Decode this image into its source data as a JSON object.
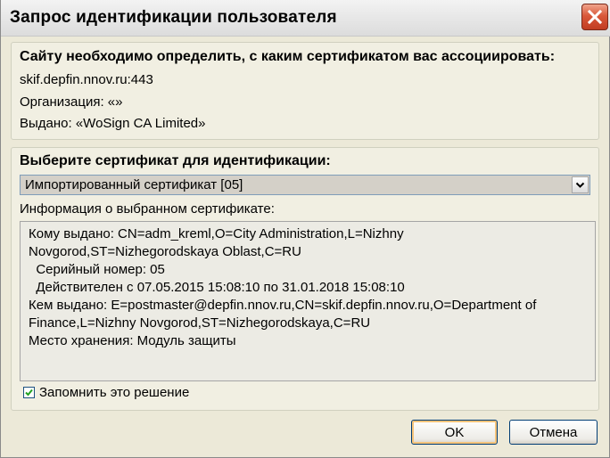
{
  "window": {
    "title": "Запрос идентификации пользователя",
    "close_icon": "close-icon"
  },
  "site_group": {
    "heading": "Сайту необходимо определить, с каким сертификатом вас ассоциировать:",
    "host": "skif.depfin.nnov.ru:443",
    "organization": "Организация: «»",
    "issued_by": "Выдано: «WoSign CA Limited»"
  },
  "cert_group": {
    "heading": "Выберите сертификат для идентификации:",
    "selected_certificate": "Импортированный сертификат [05]",
    "info_label": "Информация о выбранном сертификате:",
    "info_lines": [
      "Кому выдано: CN=adm_kreml,O=City Administration,L=Nizhny",
      "Novgorod,ST=Nizhegorodskaya Oblast,C=RU",
      "  Серийный номер: 05",
      "  Действителен с 07.05.2015 15:08:10 по 31.01.2018 15:08:10",
      "Кем выдано: E=postmaster@depfin.nnov.ru,CN=skif.depfin.nnov.ru,O=Department of",
      "Finance,L=Nizhny Novgorod,ST=Nizhegorodskaya,C=RU",
      "Место хранения: Модуль защиты"
    ],
    "remember_checked": true,
    "remember_label": "Запомнить это решение"
  },
  "buttons": {
    "ok": "OK",
    "cancel": "Отмена"
  }
}
